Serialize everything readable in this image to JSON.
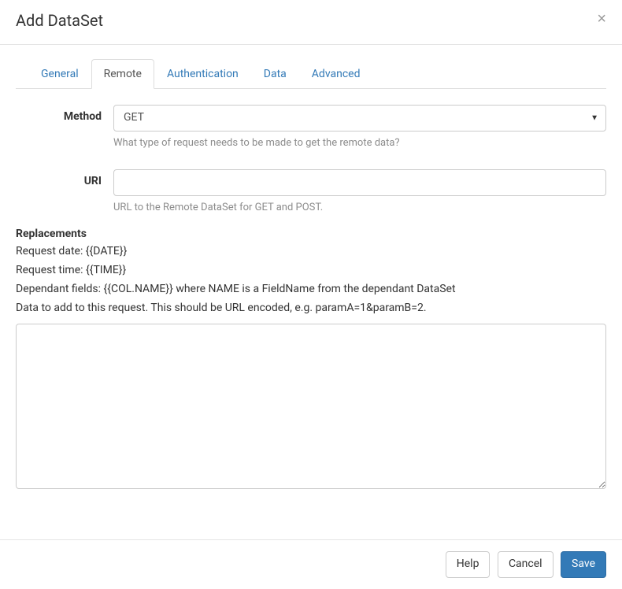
{
  "header": {
    "title": "Add DataSet",
    "close": "×"
  },
  "tabs": [
    {
      "label": "General"
    },
    {
      "label": "Remote"
    },
    {
      "label": "Authentication"
    },
    {
      "label": "Data"
    },
    {
      "label": "Advanced"
    }
  ],
  "form": {
    "method": {
      "label": "Method",
      "value": "GET",
      "help": "What type of request needs to be made to get the remote data?"
    },
    "uri": {
      "label": "URI",
      "value": "",
      "help": "URL to the Remote DataSet for GET and POST."
    },
    "replacements": {
      "title": "Replacements",
      "line1": "Request date: {{DATE}}",
      "line2": "Request time: {{TIME}}",
      "line3": "Dependant fields: {{COL.NAME}} where NAME is a FieldName from the dependant DataSet",
      "line4": "Data to add to this request. This should be URL encoded, e.g. paramA=1&paramB=2.",
      "textarea_value": ""
    }
  },
  "footer": {
    "help": "Help",
    "cancel": "Cancel",
    "save": "Save"
  }
}
